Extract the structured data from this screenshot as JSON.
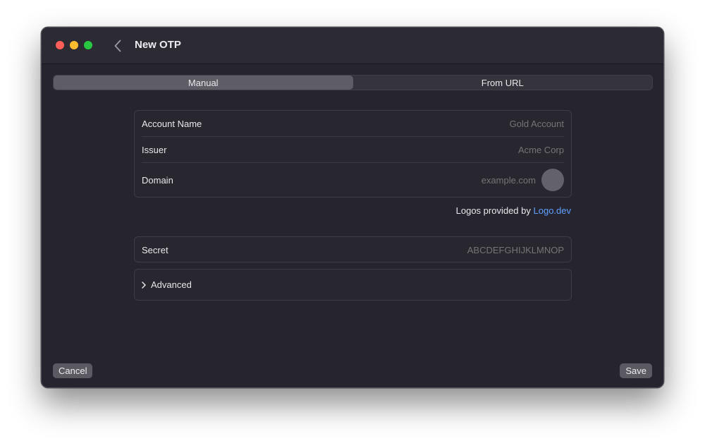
{
  "window": {
    "title": "New OTP"
  },
  "tabs": [
    {
      "label": "Manual",
      "selected": true
    },
    {
      "label": "From URL",
      "selected": false
    }
  ],
  "account": {
    "name_label": "Account Name",
    "name_placeholder": "Gold Account",
    "issuer_label": "Issuer",
    "issuer_placeholder": "Acme Corp",
    "domain_label": "Domain",
    "domain_placeholder": "example.com"
  },
  "logos": {
    "prefix": "Logos provided by",
    "link": "Logo.dev"
  },
  "secret": {
    "label": "Secret",
    "placeholder": "ABCDEFGHIJKLMNOP"
  },
  "advanced": {
    "label": "Advanced",
    "icon": "chevron-right-icon"
  },
  "footer": {
    "cancel_label": "Cancel",
    "save_label": "Save"
  },
  "colors": {
    "window_bg": "#26252f",
    "link": "#5fa0ff",
    "close": "#ff5f57",
    "minimize": "#febc2e",
    "maximize": "#28c840"
  }
}
